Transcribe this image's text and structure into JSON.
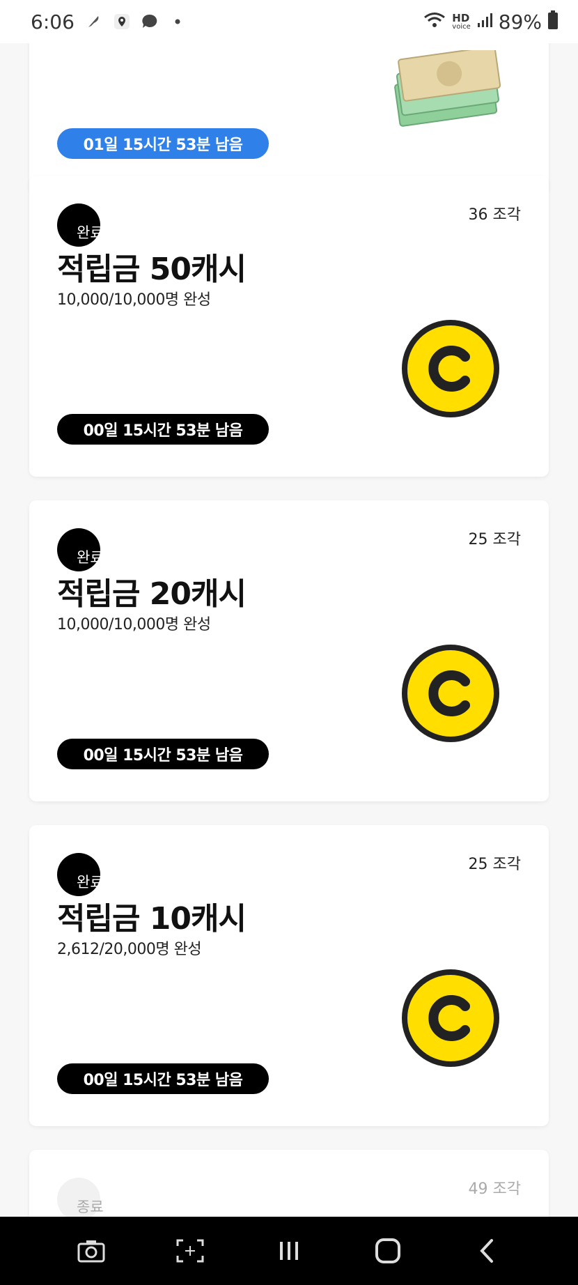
{
  "status_bar": {
    "time": "6:06",
    "battery": "89%",
    "network_label": "HD",
    "network_sub": "voice"
  },
  "cards": [
    {
      "timer": "01일 15시간 53분 남음",
      "timer_style": "blue"
    },
    {
      "status_label": "완료",
      "pieces": "36 조각",
      "title": "적립금 50캐시",
      "progress": "10,000/10,000명 완성",
      "timer": "00일 15시간 53분 남음"
    },
    {
      "status_label": "완료",
      "pieces": "25 조각",
      "title": "적립금 20캐시",
      "progress": "10,000/10,000명 완성",
      "timer": "00일 15시간 53분 남음"
    },
    {
      "status_label": "완료",
      "pieces": "25 조각",
      "title": "적립금 10캐시",
      "progress": "2,612/20,000명 완성",
      "timer": "00일 15시간 53분 남음"
    },
    {
      "status_label": "종료",
      "pieces": "49 조각"
    }
  ],
  "icons": {
    "coin": "c-coin-icon",
    "money": "cash-bills-icon",
    "camera": "camera-icon",
    "scan": "scan-icon",
    "recents": "recents-icon",
    "home": "home-icon",
    "back": "back-icon"
  },
  "colors": {
    "timer_blue": "#2f80e8",
    "timer_black": "#000000",
    "coin_yellow": "#ffde00"
  }
}
